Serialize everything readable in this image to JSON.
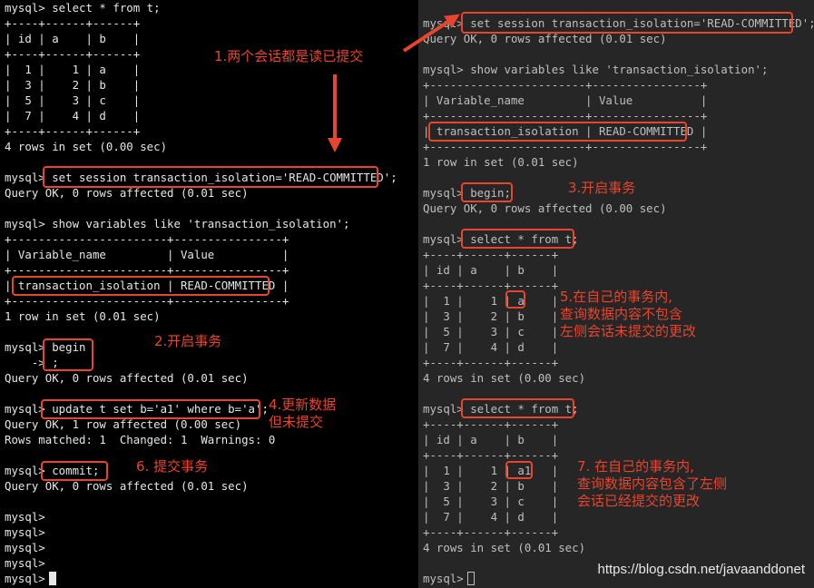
{
  "left": {
    "lines": [
      "mysql> select * from t;",
      "+----+------+------+",
      "| id | a    | b    |",
      "+----+------+------+",
      "|  1 |    1 | a    |",
      "|  3 |    2 | b    |",
      "|  5 |    3 | c    |",
      "|  7 |    4 | d    |",
      "+----+------+------+",
      "4 rows in set (0.00 sec)",
      "",
      "mysql> set session transaction_isolation='READ-COMMITTED';",
      "Query OK, 0 rows affected (0.01 sec)",
      "",
      "mysql> show variables like 'transaction_isolation';",
      "+-----------------------+----------------+",
      "| Variable_name         | Value          |",
      "+-----------------------+----------------+",
      "| transaction_isolation | READ-COMMITTED |",
      "+-----------------------+----------------+",
      "1 row in set (0.01 sec)",
      "",
      "mysql> begin",
      "    -> ;",
      "Query OK, 0 rows affected (0.01 sec)",
      "",
      "mysql> update t set b='a1' where b='a';",
      "Query OK, 1 row affected (0.00 sec)",
      "Rows matched: 1  Changed: 1  Warnings: 0",
      "",
      "mysql> commit;",
      "Query OK, 0 rows affected (0.01 sec)",
      "",
      "mysql>",
      "mysql>",
      "mysql>",
      "mysql>",
      "mysql>"
    ]
  },
  "right": {
    "lines": [
      "mysql> set session transaction_isolation='READ-COMMITTED';",
      "Query OK, 0 rows affected (0.01 sec)",
      "",
      "mysql> show variables like 'transaction_isolation';",
      "+-----------------------+----------------+",
      "| Variable_name         | Value          |",
      "+-----------------------+----------------+",
      "| transaction_isolation | READ-COMMITTED |",
      "+-----------------------+----------------+",
      "1 row in set (0.01 sec)",
      "",
      "mysql> begin;",
      "Query OK, 0 rows affected (0.00 sec)",
      "",
      "mysql> select * from t;",
      "+----+------+------+",
      "| id | a    | b    |",
      "+----+------+------+",
      "|  1 |    1 | a    |",
      "|  3 |    2 | b    |",
      "|  5 |    3 | c    |",
      "|  7 |    4 | d    |",
      "+----+------+------+",
      "4 rows in set (0.00 sec)",
      "",
      "mysql> select * from t;",
      "+----+------+------+",
      "| id | a    | b    |",
      "+----+------+------+",
      "|  1 |    1 | a1   |",
      "|  3 |    2 | b    |",
      "|  5 |    3 | c    |",
      "|  7 |    4 | d    |",
      "+----+------+------+",
      "4 rows in set (0.01 sec)",
      "",
      "mysql>"
    ]
  },
  "annotations": {
    "a1": "1.两个会话都是读已提交",
    "a2": "2.开启事务",
    "a3": "3.开启事务",
    "a4": "4.更新数据\n但未提交",
    "a5": "5.在自己的事务内,\n查询数据内容不包含\n左侧会话未提交的更改",
    "a6": "6. 提交事务",
    "a7": "7. 在自己的事务内,\n查询数据内容包含了左侧\n会话已经提交的更改"
  },
  "watermark": "https://blog.csdn.net/javaanddonet",
  "colors": {
    "accent": "#e8442e",
    "left_bg": "#000000",
    "right_bg": "#262626"
  }
}
